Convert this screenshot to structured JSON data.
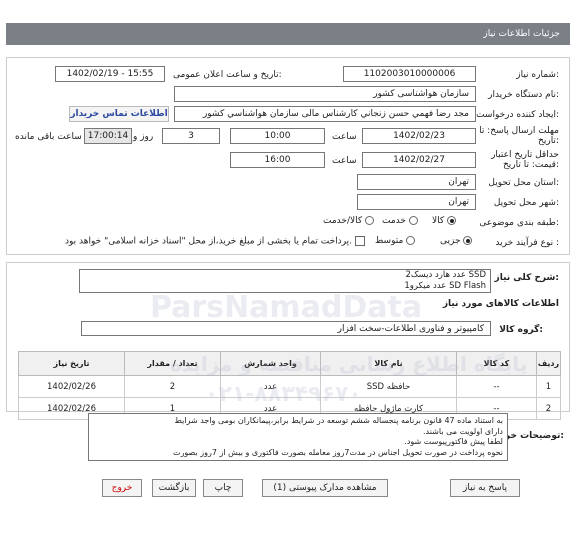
{
  "header": {
    "title": "جزئیات اطلاعات نیاز"
  },
  "fields": {
    "need_number_label": "شماره نیاز:",
    "need_number": "1102003010000006",
    "announce_label": "تاریخ و ساعت اعلان عمومی:",
    "announce_value": "1402/02/19 - 15:55",
    "buyer_org_label": "نام دستگاه خریدار:",
    "buyer_org": "سازمان هواشناسی کشور",
    "creator_label": "ایجاد کننده درخواست:",
    "creator": "مجد رضا فهمي حسن زنجاني کارشناس مالی سازمان هواشناسي کشور",
    "contact_link": "اطلاعات تماس خریدار",
    "deadline_label": "مهلت ارسال پاسخ: تا تاریخ:",
    "deadline_date": "1402/02/23",
    "time_label": "ساعت",
    "deadline_time": "10:00",
    "days_value": "3",
    "days_label": "روز و",
    "remaining_time": "17:00:14",
    "remaining_label": "ساعت باقی مانده",
    "validity_label": "حداقل تاریخ اعتبار قیمت: تا تاریخ:",
    "validity_date": "1402/02/27",
    "validity_time_label": "ساعت",
    "validity_time": "16:00",
    "province_label": "استان محل تحویل:",
    "province": "تهران",
    "city_label": "شهر محل تحویل:",
    "city": "تهران",
    "category_label": "طبقه بندی موضوعی:",
    "category_options": [
      "کالا",
      "خدمت",
      "کالا/خدمت"
    ],
    "process_label": "نوع فرآیند خرید :",
    "process_options": [
      "جزیی",
      "متوسط"
    ],
    "payment_note": "پرداخت تمام یا بخشی از مبلغ خرید،از محل \"اسناد خزانه اسلامی\" خواهد بود."
  },
  "description": {
    "label": "شرح کلی نیاز:",
    "line1": "2عدد هارد دیسک SSD",
    "line2": "1عدد میکرو SD Flash"
  },
  "goods": {
    "section_title": "اطلاعات کالاهای مورد نیاز",
    "group_label": "گروه کالا:",
    "group_value": "کامپیوتر و فناوری اطلاعات-سخت افزار",
    "columns": [
      "ردیف",
      "کد کالا",
      "نام کالا",
      "واحد شمارش",
      "تعداد / مقدار",
      "تاریخ نیاز"
    ],
    "rows": [
      {
        "row": "1",
        "code": "--",
        "name": "حافظه SSD",
        "unit": "عدد",
        "qty": "2",
        "date": "1402/02/26"
      },
      {
        "row": "2",
        "code": "--",
        "name": "کارت ماژول حافظه",
        "unit": "عدد",
        "qty": "1",
        "date": "1402/02/26"
      }
    ]
  },
  "buyer_notes": {
    "label": "توضیحات خریدار:",
    "line1": "به استناد ماده 47 قانون برنامه پنجساله ششم توسعه در شرایط برابر،پیمانکاران بومی واجد شرایط",
    "line2": "دارای اولویت می باشند.",
    "line3": "لطفا پیش فاکتورپیوست شود.",
    "line4": "نحوه پرداخت در صورت تحویل اجناس در مدت7روز معامله بصورت فاکتوری و بیش از 7روز بصورت"
  },
  "buttons": {
    "reply": "پاسخ به نیاز",
    "view_docs": "مشاهده مدارک پیوستی (1)",
    "print": "چاپ",
    "back": "بازگشت",
    "exit": "خروج"
  },
  "watermark": {
    "brand": "ParsNamadData",
    "line_fa": "پایگاه اطلاع رسانی مناقصه و مزایده",
    "phone": "۰۲۱-۸۸۳۴۹۶۷۰"
  }
}
